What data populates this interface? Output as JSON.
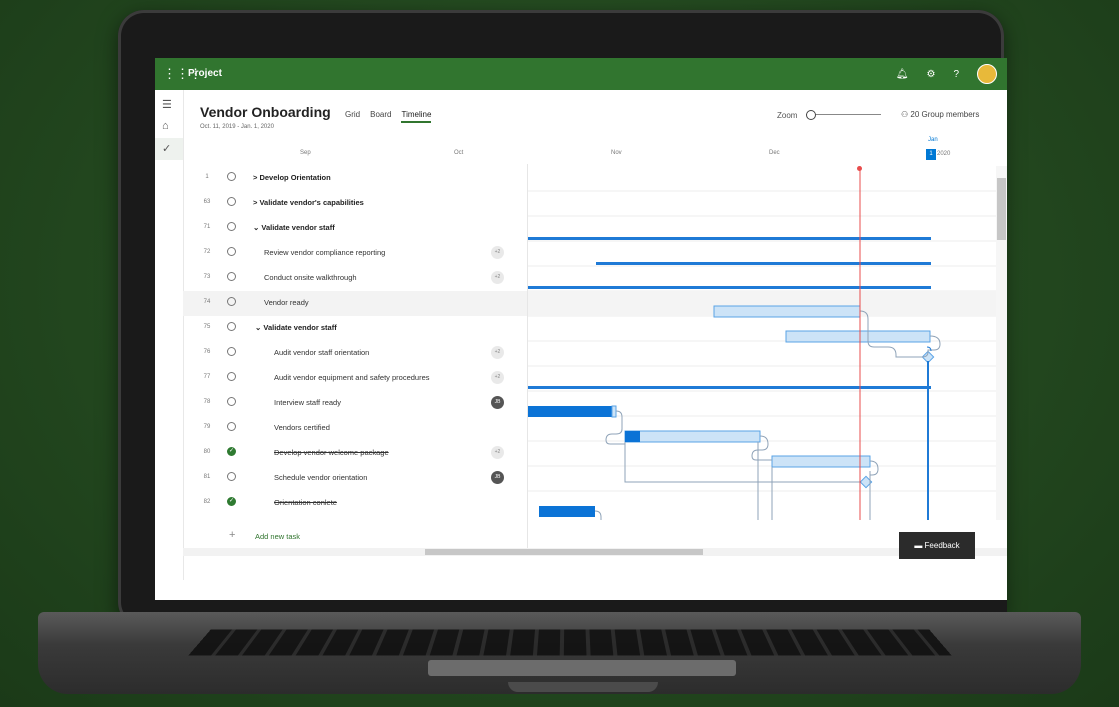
{
  "app": {
    "name": "Project",
    "waffle_icon": "waffle-icon"
  },
  "top_icons": [
    "bell-icon",
    "gear-icon",
    "help-icon",
    "avatar"
  ],
  "top_help": "?",
  "project": {
    "title": "Vendor Onboarding",
    "dates": "Oct. 11, 2019 - Jan. 1, 2020"
  },
  "views": [
    {
      "label": "Grid"
    },
    {
      "label": "Board"
    },
    {
      "label": "Timeline"
    }
  ],
  "zoom": {
    "label": "Zoom"
  },
  "members": {
    "label": "20 Group members"
  },
  "months": [
    "Sep",
    "Oct",
    "Nov",
    "Dec"
  ],
  "jan": {
    "label": "Jan",
    "day": "1",
    "year": "2020"
  },
  "tasks": [
    {
      "num": "1",
      "name": "> Develop Orientation",
      "summary": true
    },
    {
      "num": "63",
      "name": "> Validate vendor's capabilities",
      "summary": true
    },
    {
      "num": "71",
      "name": "⌄ Validate vendor staff",
      "summary": true
    },
    {
      "num": "72",
      "name": "Review vendor compliance reporting",
      "badge": "+2"
    },
    {
      "num": "73",
      "name": "Conduct onsite walkthrough",
      "badge": "+2"
    },
    {
      "num": "74",
      "name": "Vendor ready"
    },
    {
      "num": "75",
      "name": "⌄ Validate vendor staff",
      "summary": true
    },
    {
      "num": "76",
      "name": "Audit vendor staff orientation",
      "badge": "+2"
    },
    {
      "num": "77",
      "name": "Audit vendor equipment and safety procedures",
      "badge": "+2"
    },
    {
      "num": "78",
      "name": "Interview staff ready",
      "badge": "JB"
    },
    {
      "num": "79",
      "name": "Vendors certified"
    },
    {
      "num": "80",
      "name": "Develop vendor welcome package",
      "badge": "+2",
      "done": true
    },
    {
      "num": "81",
      "name": "Schedule vendor orientation",
      "badge": "JB"
    },
    {
      "num": "82",
      "name": "Orientation conlete",
      "done": true
    }
  ],
  "add_task": {
    "label": "Add new task"
  },
  "feedback": {
    "label": "Feedback"
  }
}
